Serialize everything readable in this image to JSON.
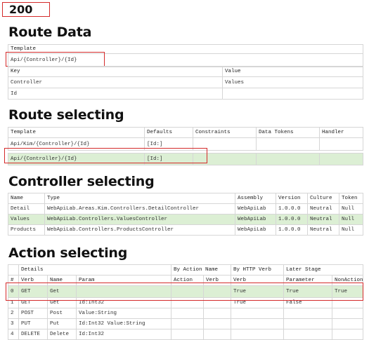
{
  "status": "200",
  "route_data": {
    "heading": "Route Data",
    "template_header": "Template",
    "template_value": "Api/{Controller}/{Id}",
    "columns": [
      "Key",
      "Value"
    ],
    "rows": [
      [
        "Controller",
        "Values"
      ],
      [
        "Id",
        ""
      ]
    ]
  },
  "route_selecting": {
    "heading": "Route selecting",
    "columns": [
      "Template",
      "Defaults",
      "Constraints",
      "Data Tokens",
      "Handler"
    ],
    "rows": [
      [
        "Api/Kim/{Controller}/{Id}",
        "[Id:]",
        "",
        "",
        ""
      ],
      [
        "Api/{Controller}/{Id}",
        "[Id:]",
        "",
        "",
        ""
      ]
    ]
  },
  "controller_selecting": {
    "heading": "Controller selecting",
    "columns": [
      "Name",
      "Type",
      "Assembly",
      "Version",
      "Culture",
      "Token"
    ],
    "rows": [
      [
        "Detail",
        "WebApiLab.Areas.Kim.Controllers.DetailController",
        "WebApiLab",
        "1.0.0.0",
        "Neutral",
        "Null"
      ],
      [
        "Values",
        "WebApiLab.Controllers.ValuesController",
        "WebApiLab",
        "1.0.0.0",
        "Neutral",
        "Null"
      ],
      [
        "Products",
        "WebApiLab.Controllers.ProductsController",
        "WebApiLab",
        "1.0.0.0",
        "Neutral",
        "Null"
      ]
    ]
  },
  "action_selecting": {
    "heading": "Action selecting",
    "group_headers": [
      "Details",
      "By Action Name",
      "By HTTP Verb",
      "Later Stage"
    ],
    "columns": [
      "#",
      "Verb",
      "Name",
      "Param",
      "Action",
      "Verb",
      "Verb",
      "Parameter",
      "NonAction"
    ],
    "rows": [
      [
        "0",
        "GET",
        "Get",
        "",
        "",
        "",
        "True",
        "True",
        "True"
      ],
      [
        "1",
        "GET",
        "Get",
        "Id:Int32",
        "",
        "",
        "True",
        "False",
        ""
      ],
      [
        "2",
        "POST",
        "Post",
        "Value:String",
        "",
        "",
        "",
        "",
        ""
      ],
      [
        "3",
        "PUT",
        "Put",
        "Id:Int32 Value:String",
        "",
        "",
        "",
        "",
        ""
      ],
      [
        "4",
        "DELETE",
        "Delete",
        "Id:Int32",
        "",
        "",
        "",
        "",
        ""
      ]
    ]
  },
  "colors": {
    "highlight_row": "#dcefd4",
    "annotation_box": "#d42a2a",
    "border": "#d6d6d6"
  }
}
